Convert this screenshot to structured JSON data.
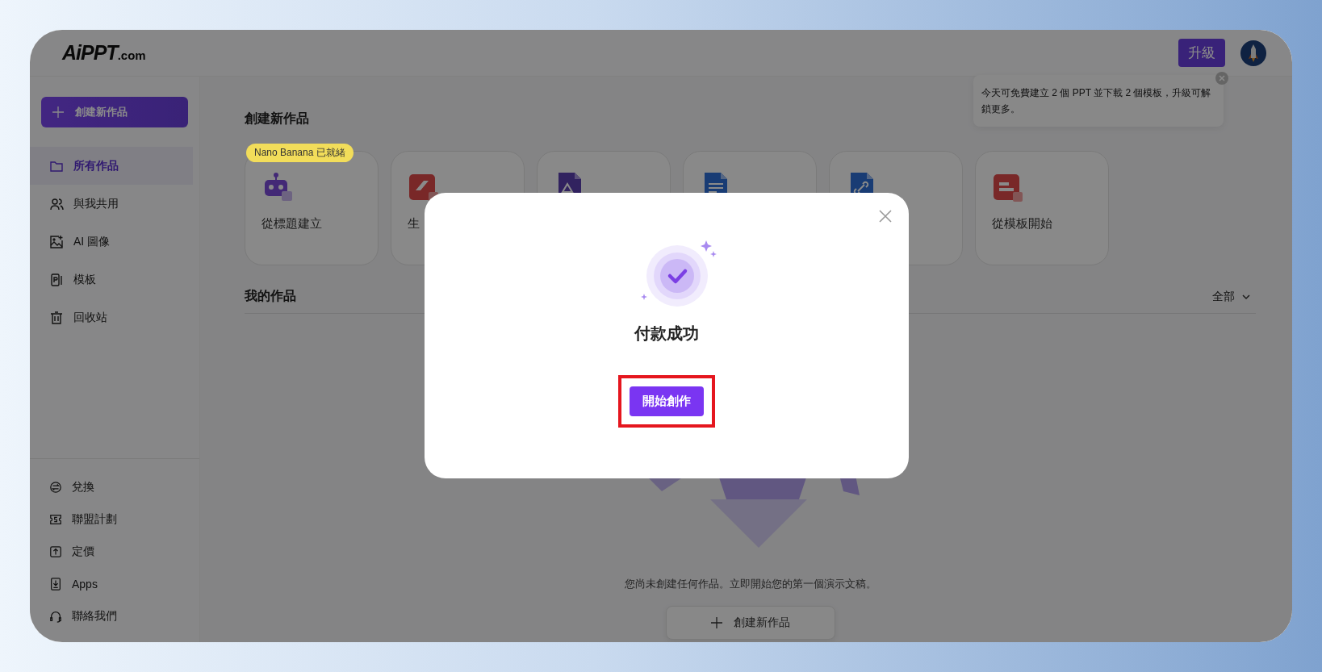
{
  "header": {
    "logo": {
      "main": "AiPPT",
      "suffix": ".com"
    },
    "upgrade_button": "升級"
  },
  "tooltip": {
    "text": "今天可免費建立 2 個 PPT 並下載 2 個模板，升級可解鎖更多。"
  },
  "sidebar": {
    "create_button": "創建新作品",
    "items": [
      {
        "label": "所有作品",
        "selected": true
      },
      {
        "label": "與我共用",
        "selected": false
      },
      {
        "label": "AI 圖像",
        "selected": false
      },
      {
        "label": "模板",
        "selected": false
      },
      {
        "label": "回收站",
        "selected": false
      }
    ],
    "bottom_items": [
      {
        "label": "兌換"
      },
      {
        "label": "聯盟計劃"
      },
      {
        "label": "定價"
      },
      {
        "label": "Apps"
      },
      {
        "label": "聯絡我們"
      }
    ]
  },
  "create_section": {
    "title": "創建新作品",
    "cards": [
      {
        "kind": "labeled",
        "label": "從標題建立",
        "badge": "Nano Banana 已就緒"
      },
      {
        "kind": "labeled",
        "label": "生"
      },
      {
        "kind": "icon-only"
      },
      {
        "kind": "icon-only"
      },
      {
        "kind": "icon-only"
      },
      {
        "kind": "labeled",
        "label": "從模板開始"
      }
    ]
  },
  "my_works": {
    "title": "我的作品",
    "filter": "全部",
    "empty_text": "您尚未創建任何作品。立即開始您的第一個演示文稿。",
    "create_button": "創建新作品"
  },
  "modal": {
    "title": "付款成功",
    "button": {
      "label": "開始創作",
      "highlighted": true
    }
  }
}
